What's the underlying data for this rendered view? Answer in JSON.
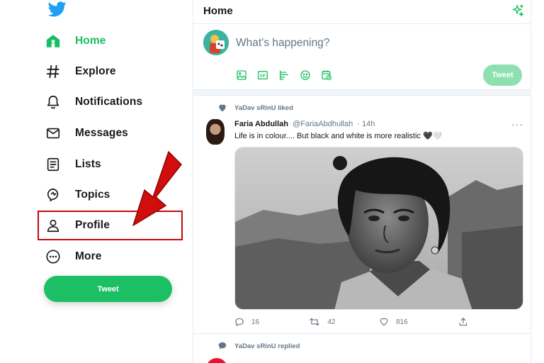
{
  "sidebar": {
    "items": [
      {
        "label": "Home",
        "icon": "home-icon",
        "active": true
      },
      {
        "label": "Explore",
        "icon": "hashtag-icon"
      },
      {
        "label": "Notifications",
        "icon": "bell-icon"
      },
      {
        "label": "Messages",
        "icon": "envelope-icon"
      },
      {
        "label": "Lists",
        "icon": "list-icon"
      },
      {
        "label": "Topics",
        "icon": "topics-icon"
      },
      {
        "label": "Profile",
        "icon": "person-icon"
      },
      {
        "label": "More",
        "icon": "more-circle-icon"
      }
    ],
    "tweet_button": "Tweet"
  },
  "colors": {
    "brand_green": "#17bf63",
    "highlight_red": "#c40a0a",
    "logo_blue": "#1da1f2"
  },
  "header": {
    "title": "Home"
  },
  "compose": {
    "placeholder": "What’s happening?",
    "tools": [
      "image-icon",
      "gif-icon",
      "poll-icon",
      "emoji-icon",
      "schedule-icon"
    ],
    "tweet_button": "Tweet"
  },
  "feed": [
    {
      "social_context": "YaDav sRinU liked",
      "name": "Faria Abdullah",
      "handle": "@FariaAbdhullah",
      "time": "· 14h",
      "text": "Life is in colour.... But black and white is more realistic 🖤🤍",
      "replies": "16",
      "retweets": "42",
      "likes": "816",
      "more": "···"
    },
    {
      "social_context": "YaDav sRinU replied"
    }
  ]
}
